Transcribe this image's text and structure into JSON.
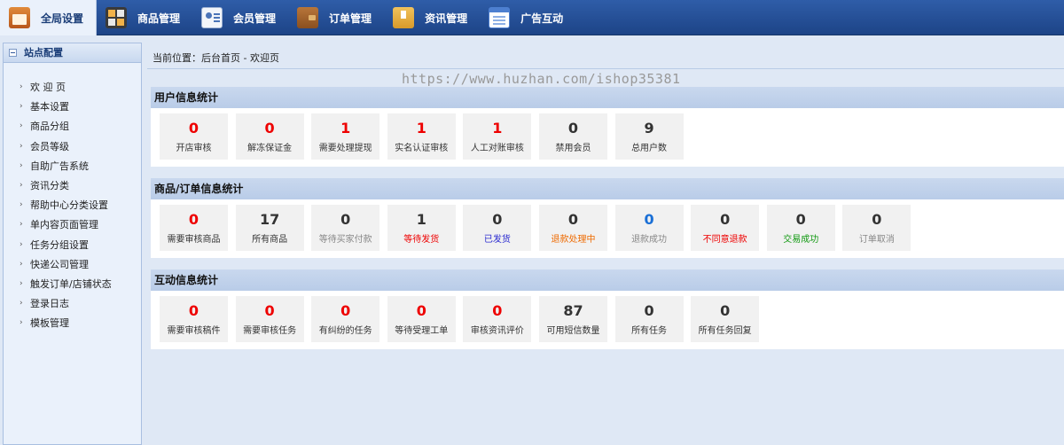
{
  "nav": {
    "tabs": [
      {
        "label": "全局设置",
        "icon": "home-icon",
        "active": true
      },
      {
        "label": "商品管理",
        "icon": "grid-icon"
      },
      {
        "label": "会员管理",
        "icon": "member-card-icon"
      },
      {
        "label": "订单管理",
        "icon": "wallet-icon"
      },
      {
        "label": "资讯管理",
        "icon": "folder-icon"
      },
      {
        "label": "广告互动",
        "icon": "window-icon"
      }
    ]
  },
  "sidebar": {
    "title": "站点配置",
    "items": [
      {
        "label": "欢 迎 页"
      },
      {
        "label": "基本设置"
      },
      {
        "label": "商品分组"
      },
      {
        "label": "会员等级"
      },
      {
        "label": "自助广告系统"
      },
      {
        "label": "资讯分类"
      },
      {
        "label": "帮助中心分类设置"
      },
      {
        "label": "单内容页面管理"
      },
      {
        "label": "任务分组设置"
      },
      {
        "label": "快递公司管理"
      },
      {
        "label": "触发订单/店铺状态"
      },
      {
        "label": "登录日志"
      },
      {
        "label": "模板管理"
      }
    ]
  },
  "breadcrumb": "当前位置：后台首页 - 欢迎页",
  "watermark": "https://www.huzhan.com/ishop35381",
  "sections": [
    {
      "title": "用户信息统计",
      "stats": [
        {
          "value": "0",
          "label": "开店审核",
          "color": "#ee0000"
        },
        {
          "value": "0",
          "label": "解冻保证金",
          "color": "#ee0000"
        },
        {
          "value": "1",
          "label": "需要处理提现",
          "color": "#ee0000"
        },
        {
          "value": "1",
          "label": "实名认证审核",
          "color": "#ee0000"
        },
        {
          "value": "1",
          "label": "人工对账审核",
          "color": "#ee0000"
        },
        {
          "value": "0",
          "label": "禁用会员",
          "color": "#333333"
        },
        {
          "value": "9",
          "label": "总用户数",
          "color": "#333333"
        }
      ]
    },
    {
      "title": "商品/订单信息统计",
      "stats": [
        {
          "value": "0",
          "label": "需要审核商品",
          "color": "#ee0000"
        },
        {
          "value": "17",
          "label": "所有商品",
          "color": "#333333"
        },
        {
          "value": "0",
          "label": "等待买家付款",
          "color": "#333333",
          "label_color": "gray"
        },
        {
          "value": "1",
          "label": "等待发货",
          "color": "#333333",
          "label_color": "red"
        },
        {
          "value": "0",
          "label": "已发货",
          "color": "#333333",
          "label_color": "blue"
        },
        {
          "value": "0",
          "label": "退款处理中",
          "color": "#333333",
          "label_color": "orange"
        },
        {
          "value": "0",
          "label": "退款成功",
          "color": "#1a6fd6",
          "label_color": "gray"
        },
        {
          "value": "0",
          "label": "不同意退款",
          "color": "#333333",
          "label_color": "red"
        },
        {
          "value": "0",
          "label": "交易成功",
          "color": "#333333",
          "label_color": "green"
        },
        {
          "value": "0",
          "label": "订单取消",
          "color": "#333333",
          "label_color": "gray"
        }
      ]
    },
    {
      "title": "互动信息统计",
      "stats": [
        {
          "value": "0",
          "label": "需要审核稿件",
          "color": "#ee0000"
        },
        {
          "value": "0",
          "label": "需要审核任务",
          "color": "#ee0000"
        },
        {
          "value": "0",
          "label": "有纠纷的任务",
          "color": "#ee0000"
        },
        {
          "value": "0",
          "label": "等待受理工单",
          "color": "#ee0000"
        },
        {
          "value": "0",
          "label": "审核资讯评价",
          "color": "#ee0000"
        },
        {
          "value": "87",
          "label": "可用短信数量",
          "color": "#333333"
        },
        {
          "value": "0",
          "label": "所有任务",
          "color": "#333333"
        },
        {
          "value": "0",
          "label": "所有任务回复",
          "color": "#333333"
        }
      ]
    }
  ]
}
